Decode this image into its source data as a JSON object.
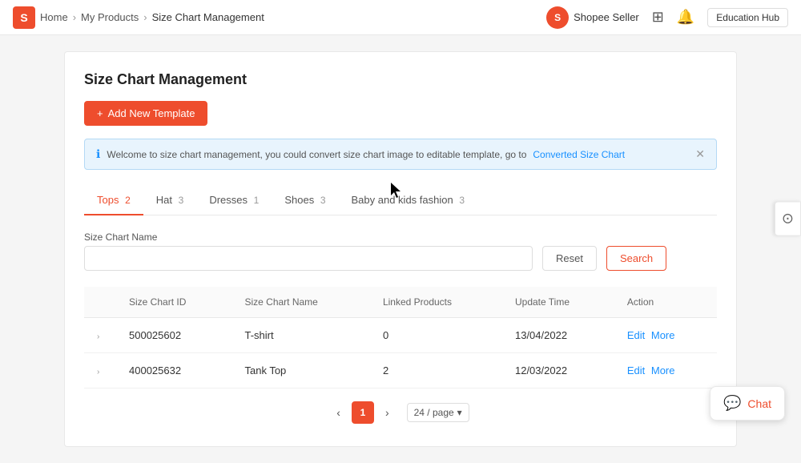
{
  "nav": {
    "logo_text": "S",
    "home": "Home",
    "my_products": "My Products",
    "current": "Size Chart Management",
    "seller_logo": "S",
    "seller_name": "Shopee Seller",
    "education_hub": "Education Hub"
  },
  "page": {
    "title": "Size Chart Management",
    "add_btn_label": "+ Add New Template"
  },
  "banner": {
    "message": "Welcome to size chart management, you could convert size chart image to editable template, go to",
    "link_text": "Converted Size Chart"
  },
  "tabs": [
    {
      "label": "Tops",
      "count": "2",
      "active": true
    },
    {
      "label": "Hat",
      "count": "3",
      "active": false
    },
    {
      "label": "Dresses",
      "count": "1",
      "active": false
    },
    {
      "label": "Shoes",
      "count": "3",
      "active": false
    },
    {
      "label": "Baby and kids fashion",
      "count": "3",
      "active": false
    }
  ],
  "search": {
    "label": "Size Chart Name",
    "placeholder": "",
    "reset_label": "Reset",
    "search_label": "Search"
  },
  "table": {
    "columns": [
      "",
      "Size Chart ID",
      "Size Chart Name",
      "Linked Products",
      "Update Time",
      "Action"
    ],
    "rows": [
      {
        "id": "500025602",
        "name": "T-shirt",
        "linked": "0",
        "updated": "13/04/2022",
        "edit": "Edit",
        "more": "More"
      },
      {
        "id": "400025632",
        "name": "Tank Top",
        "linked": "2",
        "updated": "12/03/2022",
        "edit": "Edit",
        "more": "More"
      }
    ]
  },
  "pagination": {
    "current_page": "1",
    "per_page": "24 / page"
  },
  "chat": {
    "label": "Chat"
  }
}
